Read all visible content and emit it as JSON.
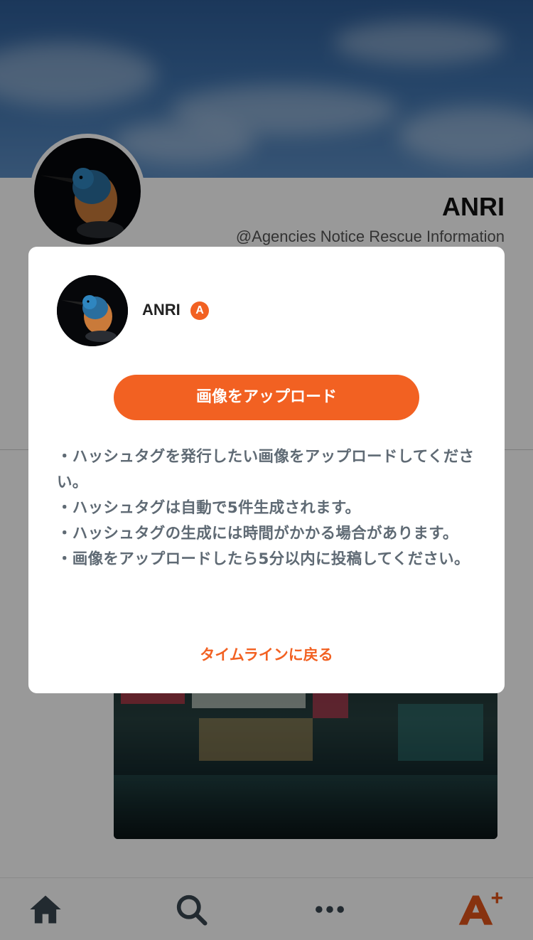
{
  "profile": {
    "name": "ANRI",
    "handle": "@Agencies Notice Rescue Information"
  },
  "modal": {
    "account_name": "ANRI",
    "badge_letter": "A",
    "upload_button": "画像をアップロード",
    "instructions": [
      "・ハッシュタグを発行したい画像をアップロードしてください。",
      "・ハッシュタグは自動で5件生成されます。",
      "・ハッシュタグの生成には時間がかかる場合があります。",
      "・画像をアップロードしたら5分以内に投稿してください。"
    ],
    "back_link": "タイムラインに戻る"
  },
  "tabbar": {
    "items": [
      {
        "icon": "home-icon"
      },
      {
        "icon": "search-icon"
      },
      {
        "icon": "more-icon"
      },
      {
        "icon": "anri-plus-icon"
      }
    ]
  },
  "colors": {
    "accent": "#f26122",
    "tab_icon": "#3a4650",
    "text_gray": "#5f6a74"
  }
}
